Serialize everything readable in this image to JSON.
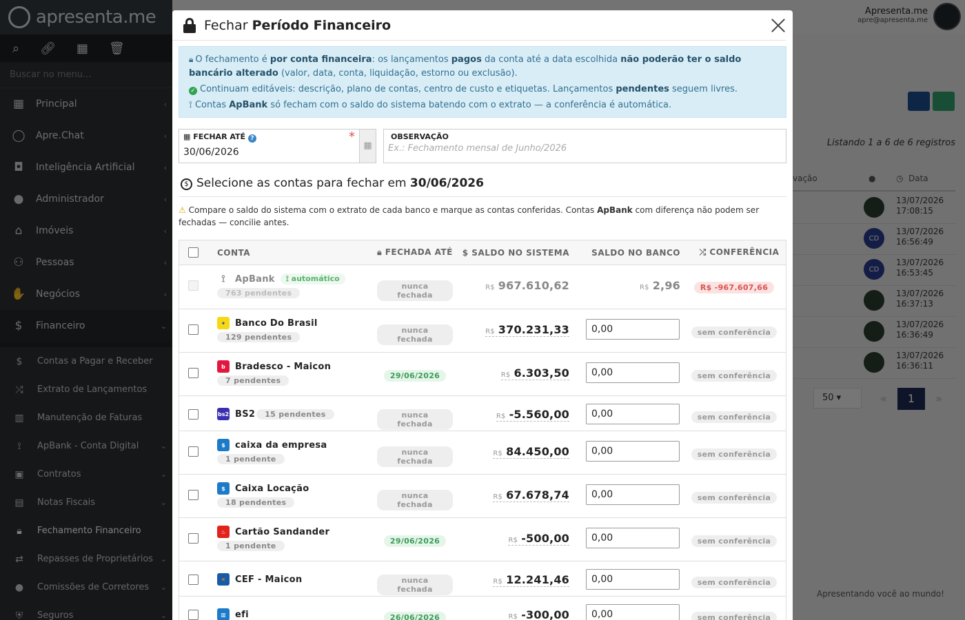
{
  "app": {
    "brand": "apresenta.me",
    "user_name": "Apresenta.me",
    "user_email": "apre@apresenta.me"
  },
  "sidebar": {
    "search_placeholder": "Buscar no menu...",
    "items": [
      {
        "label": "Principal",
        "icon": "grid-icon"
      },
      {
        "label": "Apre.Chat",
        "icon": "whatsapp-icon"
      },
      {
        "label": "Inteligência Artificial",
        "icon": "robot-icon"
      },
      {
        "label": "Administrador",
        "icon": "user-icon"
      },
      {
        "label": "Imóveis",
        "icon": "home-icon"
      },
      {
        "label": "Pessoas",
        "icon": "people-icon"
      },
      {
        "label": "Negócios",
        "icon": "handshake-icon"
      },
      {
        "label": "Financeiro",
        "icon": "dollar-icon"
      }
    ],
    "sub_items": [
      {
        "label": "Contas a Pagar e Receber",
        "icon": "dollar-icon"
      },
      {
        "label": "Extrato de Lançamentos",
        "icon": "shuffle-icon"
      },
      {
        "label": "Manutenção de Faturas",
        "icon": "barcode-icon"
      },
      {
        "label": "ApBank - Conta Digital",
        "icon": "apbank-icon"
      },
      {
        "label": "Contratos",
        "icon": "contract-icon"
      },
      {
        "label": "Notas Fiscais",
        "icon": "receipt-icon"
      },
      {
        "label": "Fechamento Financeiro",
        "icon": "lock-icon"
      },
      {
        "label": "Repasses de Proprietários",
        "icon": "transfer-icon"
      },
      {
        "label": "Comissões de Corretores",
        "icon": "user-icon"
      },
      {
        "label": "Seguros",
        "icon": "shield-icon"
      }
    ]
  },
  "background": {
    "listing": "Listando 1 a 6 de 6 registros",
    "col_obs": "vação",
    "col_data": "Data",
    "rows": [
      {
        "avatar": "",
        "date": "13/07/2026",
        "time": "17:08:15"
      },
      {
        "avatar": "CD",
        "date": "13/07/2026",
        "time": "16:56:49"
      },
      {
        "avatar": "CD",
        "date": "13/07/2026",
        "time": "16:53:45"
      },
      {
        "avatar": "",
        "date": "13/07/2026",
        "time": "16:37:13"
      },
      {
        "avatar": "",
        "date": "13/07/2026",
        "time": "16:36:49"
      },
      {
        "avatar": "",
        "date": "13/07/2026",
        "time": "16:36:11"
      }
    ],
    "page_size": "50",
    "current_page": "1",
    "footer": "Apresentando você ao mundo!"
  },
  "modal": {
    "title_prefix": "Fechar",
    "title_bold": "Período Financeiro",
    "info": {
      "p1_a": "O fechamento é ",
      "p1_b": "por conta financeira",
      "p1_c": ": os lançamentos ",
      "p1_d": "pagos",
      "p1_e": " da conta até a data escolhida ",
      "p1_f": "não poderão ter o saldo bancário alterado",
      "p1_g": " (valor, data, conta, liquidação, estorno ou exclusão).",
      "p2_a": "Continuam editáveis: descrição, plano de contas, centro de custo e etiquetas. Lançamentos ",
      "p2_b": "pendentes",
      "p2_c": " seguem livres.",
      "p3_a": "Contas ",
      "p3_b": "ApBank",
      "p3_c": " só fecham com o saldo do sistema batendo com o extrato — a conferência é automática."
    },
    "date_label": "FECHAR ATÉ",
    "date_value": "30/06/2026",
    "obs_label": "OBSERVAÇÃO",
    "obs_placeholder": "Ex.: Fechamento mensal de Junho/2026",
    "select_title": "Selecione as contas para fechar em",
    "select_date": "30/06/2026",
    "warn_a": "Compare o saldo do sistema com o extrato de cada banco e marque as contas conferidas. Contas ",
    "warn_b": "ApBank",
    "warn_c": " com diferença não podem ser fechadas — concilie antes.",
    "table": {
      "col_conta": "CONTA",
      "col_fechada": "FECHADA ATÉ",
      "col_saldo": "SALDO NO SISTEMA",
      "col_banco": "SALDO NO BANCO",
      "col_conf": "CONFERÊNCIA",
      "currency": "R$",
      "auto_label": "automático",
      "apbank": {
        "name": "ApBank",
        "pending": "763 pendentes",
        "closed": "nunca fechada",
        "system": "967.610,62",
        "bank": "2,96",
        "diff": "R$ -967.607,66"
      },
      "rows": [
        {
          "name": "Banco Do Brasil",
          "pending": "129 pendentes",
          "closed": "nunca fechada",
          "closed_type": "never",
          "system": "370.231,33",
          "bank": "0,00",
          "conf": "sem conferência",
          "logo_bg": "#f7d716",
          "logo_fg": "#1d4f9c",
          "logo_txt": "✦",
          "inline": false
        },
        {
          "name": "Bradesco - Maicon",
          "pending": "7 pendentes",
          "closed": "29/06/2026",
          "closed_type": "date",
          "system": "6.303,50",
          "bank": "0,00",
          "conf": "sem conferência",
          "logo_bg": "#e1173f",
          "logo_fg": "#ffffff",
          "logo_txt": "b",
          "inline": false
        },
        {
          "name": "BS2",
          "pending": "15 pendentes",
          "closed": "nunca fechada",
          "closed_type": "never",
          "system": "-5.560,00",
          "bank": "0,00",
          "conf": "sem conferência",
          "logo_bg": "#3a2fb0",
          "logo_fg": "#ffffff",
          "logo_txt": "bs2",
          "inline": true
        },
        {
          "name": "caixa da empresa",
          "pending": "1 pendente",
          "closed": "nunca fechada",
          "closed_type": "never",
          "system": "84.450,00",
          "bank": "0,00",
          "conf": "sem conferência",
          "logo_bg": "#1c7bc9",
          "logo_fg": "#ffffff",
          "logo_txt": "$",
          "inline": false
        },
        {
          "name": "Caixa Locação",
          "pending": "18 pendentes",
          "closed": "nunca fechada",
          "closed_type": "never",
          "system": "67.678,74",
          "bank": "0,00",
          "conf": "sem conferência",
          "logo_bg": "#1c7bc9",
          "logo_fg": "#ffffff",
          "logo_txt": "$",
          "inline": false
        },
        {
          "name": "Cartão Sandander",
          "pending": "1 pendente",
          "closed": "29/06/2026",
          "closed_type": "date",
          "system": "-500,00",
          "bank": "0,00",
          "conf": "sem conferência",
          "logo_bg": "#e2231a",
          "logo_fg": "#ffffff",
          "logo_txt": "♨",
          "inline": false
        },
        {
          "name": "CEF - Maicon",
          "pending": "",
          "closed": "nunca fechada",
          "closed_type": "never",
          "system": "12.241,46",
          "bank": "0,00",
          "conf": "sem conferência",
          "logo_bg": "#1a5ba8",
          "logo_fg": "#f39200",
          "logo_txt": "✕",
          "inline": false
        },
        {
          "name": "efi",
          "pending": "",
          "closed": "26/06/2026",
          "closed_type": "date",
          "system": "-300,00",
          "bank": "0,00",
          "conf": "sem conferência",
          "logo_bg": "#1c7bc9",
          "logo_fg": "#ffffff",
          "logo_txt": "▥",
          "inline": false
        }
      ]
    }
  }
}
